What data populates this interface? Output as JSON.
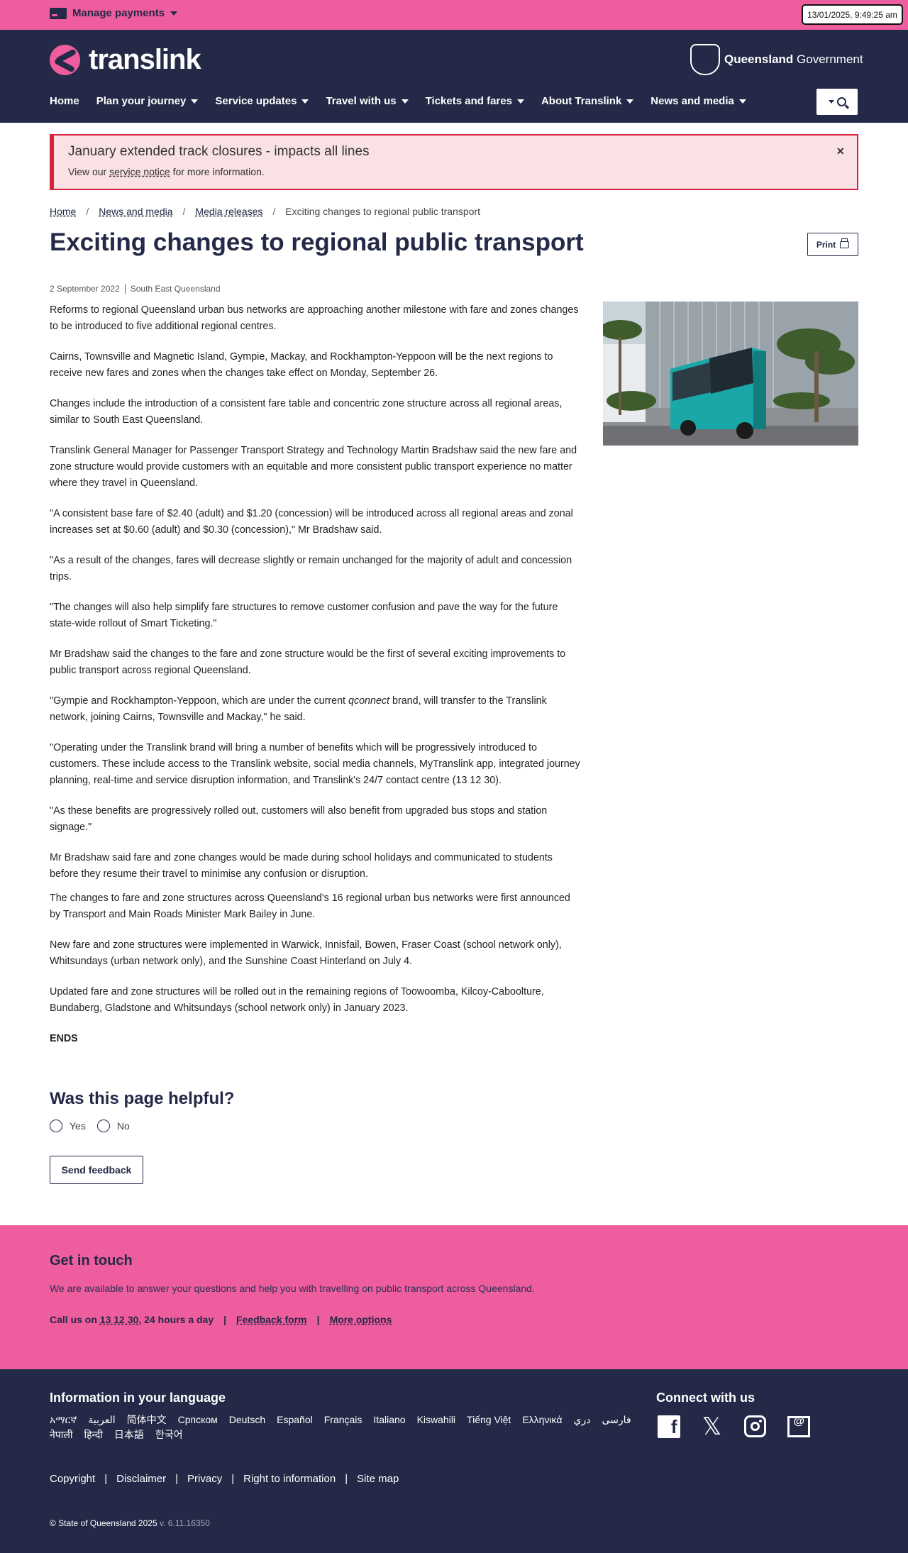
{
  "topbar": {
    "manage_label": "Manage payments",
    "datetime": "13/01/2025, 9:49:25 am"
  },
  "header": {
    "logo_text": "translink",
    "gov_bold": "Queensland",
    "gov_rest": " Government",
    "nav": [
      {
        "label": "Home",
        "dropdown": false
      },
      {
        "label": "Plan your journey",
        "dropdown": true
      },
      {
        "label": "Service updates",
        "dropdown": true
      },
      {
        "label": "Travel with us",
        "dropdown": true
      },
      {
        "label": "Tickets and fares",
        "dropdown": true
      },
      {
        "label": "About Translink",
        "dropdown": true
      },
      {
        "label": "News and media",
        "dropdown": true
      }
    ]
  },
  "alert": {
    "title": "January extended track closures - impacts all lines",
    "body_pre": "View our ",
    "body_link": "service notice",
    "body_post": " for more information.",
    "close": "×"
  },
  "breadcrumb": {
    "items": [
      "Home",
      "News and media",
      "Media releases"
    ],
    "current": "Exciting changes to regional public transport",
    "separator": "/"
  },
  "page": {
    "title": "Exciting changes to regional public transport",
    "print_label": "Print",
    "date": "2 September 2022",
    "region": "South East Queensland"
  },
  "article": {
    "p1": "Reforms to regional Queensland urban bus networks are approaching another milestone with fare and zones changes to be introduced to five additional regional centres.",
    "p2": "Cairns, Townsville and Magnetic Island, Gympie, Mackay, and Rockhampton-Yeppoon will be the next regions to receive new fares and zones when the changes take effect on Monday, September 26.",
    "p3": "Changes include the introduction of a consistent fare table and concentric zone structure across all regional areas, similar to South East Queensland.",
    "p4": "Translink General Manager for Passenger Transport Strategy and Technology Martin Bradshaw said the new fare and zone structure would provide customers with an equitable and more consistent public transport experience no matter where they travel in Queensland.",
    "p5": "\"A consistent base fare of $2.40 (adult) and $1.20 (concession) will be introduced across all regional areas and zonal increases set at $0.60 (adult) and $0.30 (concession),\" Mr Bradshaw said.",
    "p6": "\"As a result of the changes, fares will decrease slightly or remain unchanged for the majority of adult and concession trips.",
    "p7": "\"The changes will also help simplify fare structures to remove customer confusion and pave the way for the future state-wide rollout of Smart Ticketing.\"",
    "p8": "Mr Bradshaw said the changes to the fare and zone structure would be the first of several exciting improvements to public transport across regional Queensland.",
    "p9_pre": "\"Gympie and Rockhampton-Yeppoon, which are under the current ",
    "p9_italic": "qconnect",
    "p9_post": " brand, will transfer to the Translink network, joining Cairns, Townsville and Mackay,\" he said.",
    "p10": "\"Operating under the Translink brand will bring a number of benefits which will be progressively introduced to customers. These include access to the Translink website, social media channels, MyTranslink app, integrated journey planning, real-time and service disruption information, and Translink's 24/7 contact centre (13 12 30).",
    "p11": "\"As these benefits are progressively rolled out, customers will also benefit from upgraded bus stops and station signage.\"",
    "p12": "Mr Bradshaw said fare and zone changes would be made during school holidays and communicated to students before they resume their travel to minimise any confusion or disruption.",
    "p13": "The changes to fare and zone structures across Queensland's 16 regional urban bus networks were first announced by Transport and Main Roads Minister Mark Bailey in June.",
    "p14": "New fare and zone structures were implemented in Warwick, Innisfail, Bowen, Fraser Coast (school network only), Whitsundays (urban network only), and the Sunshine Coast Hinterland on July 4.",
    "p15": "Updated fare and zone structures will be rolled out in the remaining regions of Toowoomba, Kilcoy-Caboolture, Bundaberg, Gladstone and Whitsundays (school network only) in January 2023.",
    "ends": "ENDS"
  },
  "feedback": {
    "title": "Was this page helpful?",
    "yes": "Yes",
    "no": "No",
    "send": "Send feedback"
  },
  "touch": {
    "title": "Get in touch",
    "desc": "We are available to answer your questions and help you with travelling on public transport across Queensland.",
    "call_pre": "Call us on ",
    "call_link": "13 12 30",
    "call_post": ", 24 hours a day",
    "sep": "|",
    "feedback_form": "Feedback form",
    "more_options": "More options"
  },
  "footer": {
    "lang_title": "Information in your language",
    "languages": [
      "አማርኛ",
      "العربية",
      "简体中文",
      "Српском",
      "Deutsch",
      "Español",
      "Français",
      "Italiano",
      "Kiswahili",
      "Tiếng Việt",
      "Ελληνικά",
      "دري",
      "فارسی",
      "नेपाली",
      "हिन्दी",
      "日本語",
      "한국어"
    ],
    "connect_title": "Connect with us",
    "links": [
      "Copyright",
      "Disclaimer",
      "Privacy",
      "Right to information",
      "Site map"
    ],
    "link_sep": "|",
    "copyright": "© State of Queensland 2025",
    "version": " v. 6.11.16350"
  },
  "colors": {
    "pink": "#ee5d9e",
    "navy": "#232946",
    "alert_bg": "#f9e1e4",
    "alert_border": "#d8203f"
  }
}
